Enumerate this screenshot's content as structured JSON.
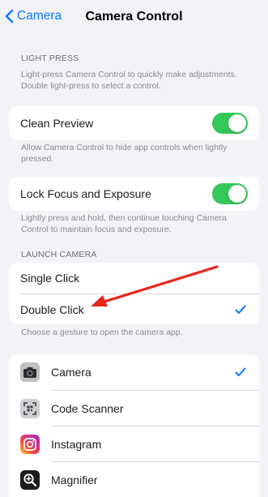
{
  "nav": {
    "back_label": "Camera",
    "title": "Camera Control"
  },
  "light_press": {
    "header": "LIGHT PRESS",
    "description": "Light-press Camera Control to quickly make adjustments. Double light-press to select a control.",
    "clean_preview": {
      "label": "Clean Preview",
      "enabled": true,
      "footer": "Allow Camera Control to hide app controls when lightly pressed."
    },
    "lock_focus": {
      "label": "Lock Focus and Exposure",
      "enabled": true,
      "footer": "Lightly press and hold, then continue touching Camera Control to maintain focus and exposure."
    }
  },
  "launch_camera": {
    "header": "LAUNCH CAMERA",
    "options": [
      {
        "label": "Single Click",
        "selected": false
      },
      {
        "label": "Double Click",
        "selected": true
      }
    ],
    "footer": "Choose a gesture to open the camera app."
  },
  "apps": [
    {
      "label": "Camera",
      "icon": "camera-app-icon",
      "selected": true
    },
    {
      "label": "Code Scanner",
      "icon": "code-scanner-app-icon",
      "selected": false
    },
    {
      "label": "Instagram",
      "icon": "instagram-app-icon",
      "selected": false
    },
    {
      "label": "Magnifier",
      "icon": "magnifier-app-icon",
      "selected": false
    }
  ],
  "colors": {
    "accent": "#0a7aff",
    "toggle_on": "#34c759",
    "annotation_arrow": "#e8261c"
  }
}
